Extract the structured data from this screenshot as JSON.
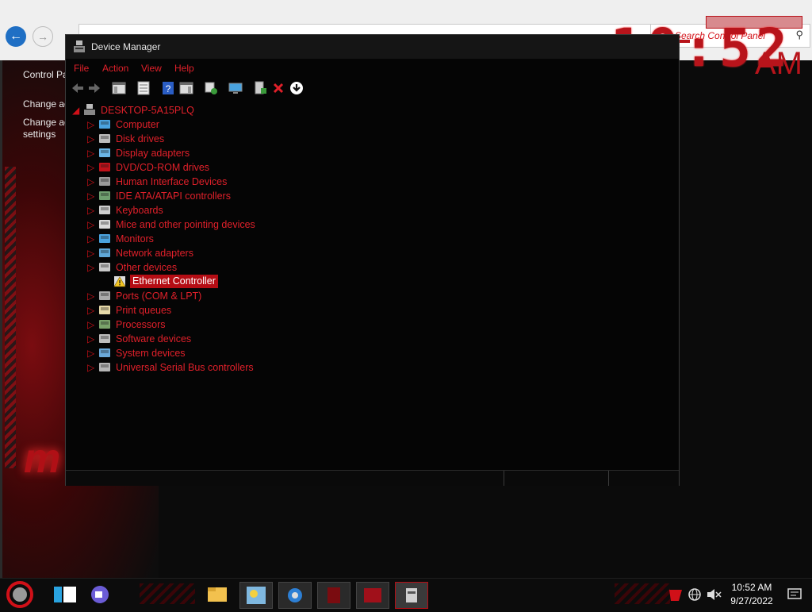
{
  "control_panel": {
    "search_placeholder": "Search Control Panel",
    "left_links": [
      "Control Pa",
      "Change ac",
      "Change ac",
      "settings"
    ]
  },
  "clock_widget": {
    "digits": "10:52",
    "ampm": "AM"
  },
  "device_manager": {
    "title": "Device Manager",
    "menu": [
      "File",
      "Action",
      "View",
      "Help"
    ],
    "computer_name": "DESKTOP-5A15PLQ",
    "categories": [
      {
        "label": "Computer",
        "icon": "computer-icon"
      },
      {
        "label": "Disk drives",
        "icon": "disk-icon"
      },
      {
        "label": "Display adapters",
        "icon": "display-adapter-icon"
      },
      {
        "label": "DVD/CD-ROM drives",
        "icon": "dvd-icon"
      },
      {
        "label": "Human Interface Devices",
        "icon": "hid-icon"
      },
      {
        "label": "IDE ATA/ATAPI controllers",
        "icon": "ide-icon"
      },
      {
        "label": "Keyboards",
        "icon": "keyboard-icon"
      },
      {
        "label": "Mice and other pointing devices",
        "icon": "mouse-icon"
      },
      {
        "label": "Monitors",
        "icon": "monitor-icon"
      },
      {
        "label": "Network adapters",
        "icon": "network-icon"
      },
      {
        "label": "Other devices",
        "icon": "unknown-device-icon"
      },
      {
        "label": "Ethernet Controller",
        "icon": "warning-device-icon",
        "child": true,
        "selected": true
      },
      {
        "label": "Ports (COM & LPT)",
        "icon": "port-icon"
      },
      {
        "label": "Print queues",
        "icon": "printer-icon"
      },
      {
        "label": "Processors",
        "icon": "processor-icon"
      },
      {
        "label": "Software devices",
        "icon": "software-icon"
      },
      {
        "label": "System devices",
        "icon": "system-icon"
      },
      {
        "label": "Universal Serial Bus controllers",
        "icon": "usb-icon"
      }
    ]
  },
  "taskbar": {
    "time": "10:52 AM",
    "date": "9/27/2022"
  },
  "colors": {
    "accent": "#e0202a",
    "selection": "#b50d14",
    "background": "#050505"
  }
}
